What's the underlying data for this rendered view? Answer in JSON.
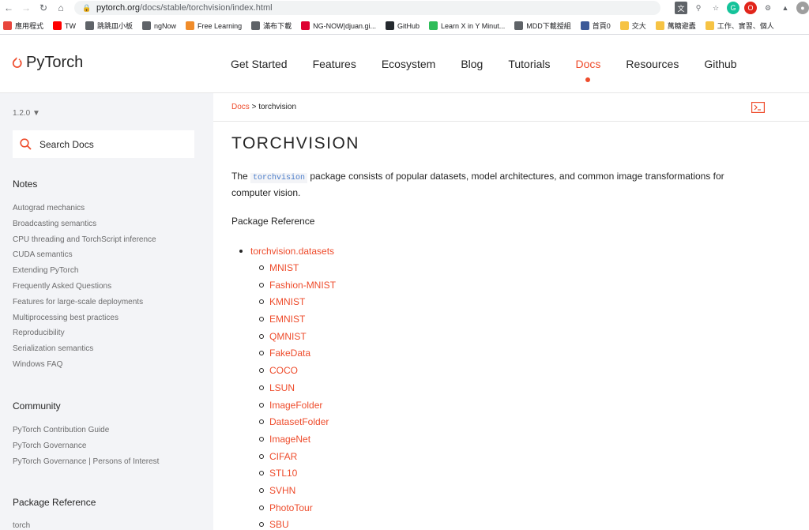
{
  "browser": {
    "url_host": "pytorch.org",
    "url_path": "/docs/stable/torchvision/index.html",
    "bookmarks": [
      {
        "label": "應用程式",
        "icon": "apps-grid-icon",
        "color": "#e8453c"
      },
      {
        "label": "TW",
        "icon": "youtube-icon",
        "color": "#ff0000"
      },
      {
        "label": "跳跳皿小板",
        "icon": "globe-icon",
        "color": "#5f6368"
      },
      {
        "label": "ngNow",
        "icon": "globe-icon",
        "color": "#5f6368"
      },
      {
        "label": "Free Learning",
        "icon": "packt-icon",
        "color": "#f08c2a"
      },
      {
        "label": "滿布下載",
        "icon": "globe-icon",
        "color": "#5f6368"
      },
      {
        "label": "NG-NOW|djuan.gi...",
        "icon": "angular-icon",
        "color": "#dd0031"
      },
      {
        "label": "GitHub",
        "icon": "github-icon",
        "color": "#24292e"
      },
      {
        "label": "Learn X in Y Minut...",
        "icon": "learnx-icon",
        "color": "#2ebd59"
      },
      {
        "label": "MDD下載授組",
        "icon": "globe-icon",
        "color": "#5f6368"
      },
      {
        "label": "首頁0",
        "icon": "facebook-icon",
        "color": "#3b5998"
      },
      {
        "label": "交大",
        "icon": "folder-icon",
        "color": "#f6c344"
      },
      {
        "label": "萬糖避蠹",
        "icon": "folder-icon",
        "color": "#f6c344"
      },
      {
        "label": "工作、實習、個人",
        "icon": "folder-icon",
        "color": "#f6c344"
      }
    ]
  },
  "site": {
    "logo_text": "PyTorch",
    "nav": [
      "Get Started",
      "Features",
      "Ecosystem",
      "Blog",
      "Tutorials",
      "Docs",
      "Resources",
      "Github"
    ],
    "active_nav": "Docs"
  },
  "sidebar": {
    "version": "1.2.0 ▼",
    "search_placeholder": "Search Docs",
    "notes_title": "Notes",
    "notes": [
      "Autograd mechanics",
      "Broadcasting semantics",
      "CPU threading and TorchScript inference",
      "CUDA semantics",
      "Extending PyTorch",
      "Frequently Asked Questions",
      "Features for large-scale deployments",
      "Multiprocessing best practices",
      "Reproducibility",
      "Serialization semantics",
      "Windows FAQ"
    ],
    "community_title": "Community",
    "community": [
      "PyTorch Contribution Guide",
      "PyTorch Governance",
      "PyTorch Governance | Persons of Interest"
    ],
    "package_title": "Package Reference",
    "package": [
      "torch"
    ]
  },
  "content": {
    "breadcrumb_link": "Docs",
    "breadcrumb_sep": " > ",
    "breadcrumb_current": "torchvision",
    "title": "TORCHVISION",
    "intro_before": "The ",
    "intro_code": "torchvision",
    "intro_after": " package consists of popular datasets, model architectures, and common image transformations for computer vision.",
    "package_reference": "Package Reference",
    "toc_top": "torchvision.datasets",
    "toc_items": [
      "MNIST",
      "Fashion-MNIST",
      "KMNIST",
      "EMNIST",
      "QMNIST",
      "FakeData",
      "COCO",
      "LSUN",
      "ImageFolder",
      "DatasetFolder",
      "ImageNet",
      "CIFAR",
      "STL10",
      "SVHN",
      "PhotoTour",
      "SBU"
    ]
  },
  "colors": {
    "accent": "#ee4c2c",
    "sidebar_bg": "#f3f4f7"
  }
}
